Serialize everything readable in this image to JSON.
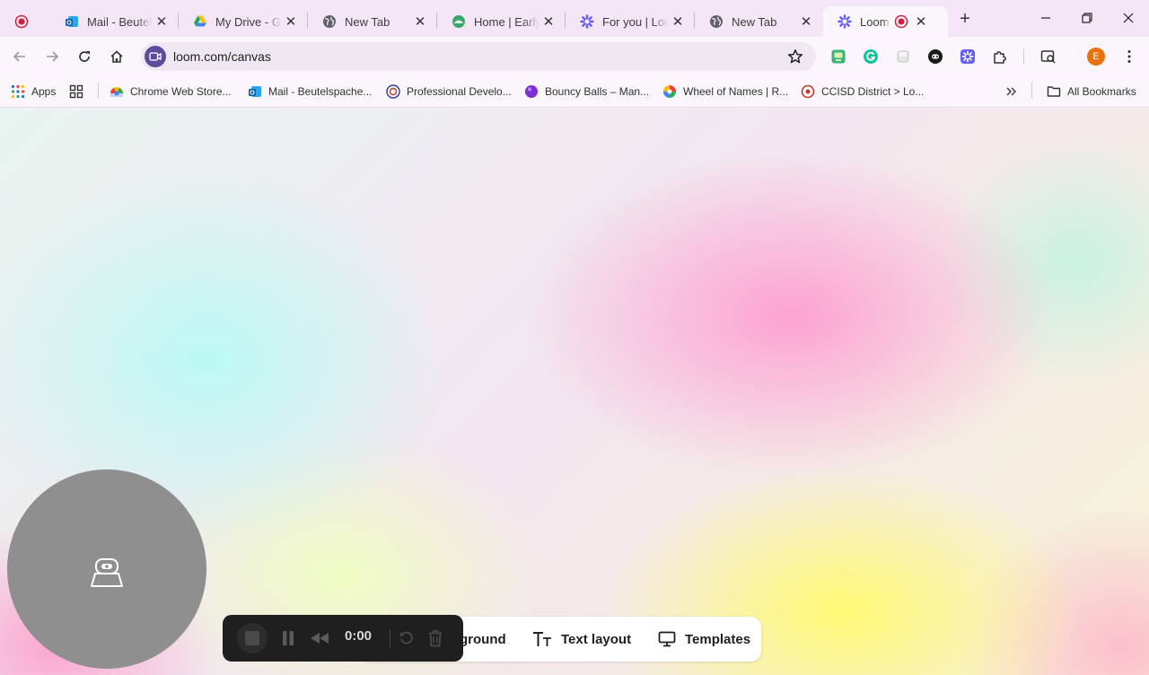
{
  "tabs": [
    {
      "title": "",
      "icon": "recording-icon",
      "active": false
    },
    {
      "title": "Mail - Beutelspacher",
      "icon": "outlook-icon",
      "active": false
    },
    {
      "title": "My Drive - Google Drive",
      "icon": "google-drive-icon",
      "active": false
    },
    {
      "title": "New Tab",
      "icon": "globe-icon",
      "active": false
    },
    {
      "title": "Home | Early",
      "icon": "website-icon",
      "active": false
    },
    {
      "title": "For you | Loom",
      "icon": "loom-icon",
      "active": false
    },
    {
      "title": "New Tab",
      "icon": "globe-icon",
      "active": false
    },
    {
      "title": "Loom | Free",
      "icon": "loom-icon",
      "active": true
    }
  ],
  "toolbar": {
    "url": "loom.com/canvas"
  },
  "bookmarks": [
    {
      "label": "Apps",
      "icon": "apps-grid-icon"
    },
    {
      "label": "",
      "icon": "dashboard-icon"
    },
    {
      "label": "Chrome Web Store...",
      "icon": "chrome-web-store-icon"
    },
    {
      "label": "Mail - Beutelspache...",
      "icon": "outlook-icon"
    },
    {
      "label": "Professional Develo...",
      "icon": "badge-icon"
    },
    {
      "label": "Bouncy Balls – Man...",
      "icon": "purple-ball-icon"
    },
    {
      "label": "Wheel of Names | R...",
      "icon": "wheel-icon"
    },
    {
      "label": "CCISD District > Lo...",
      "icon": "district-icon"
    },
    {
      "label": "All Bookmarks",
      "icon": "folder-icon"
    }
  ],
  "options_bar": {
    "background_label": "ground",
    "text_layout_label": "Text layout",
    "templates_label": "Templates"
  },
  "recording": {
    "timer": "0:00"
  },
  "profile": {
    "initial": "E",
    "color": "#e8710a"
  },
  "colors": {
    "loom_purple": "#5c4c9c",
    "controls_bg": "#1f1f1f",
    "camera_bubble": "#8f8f8f"
  }
}
